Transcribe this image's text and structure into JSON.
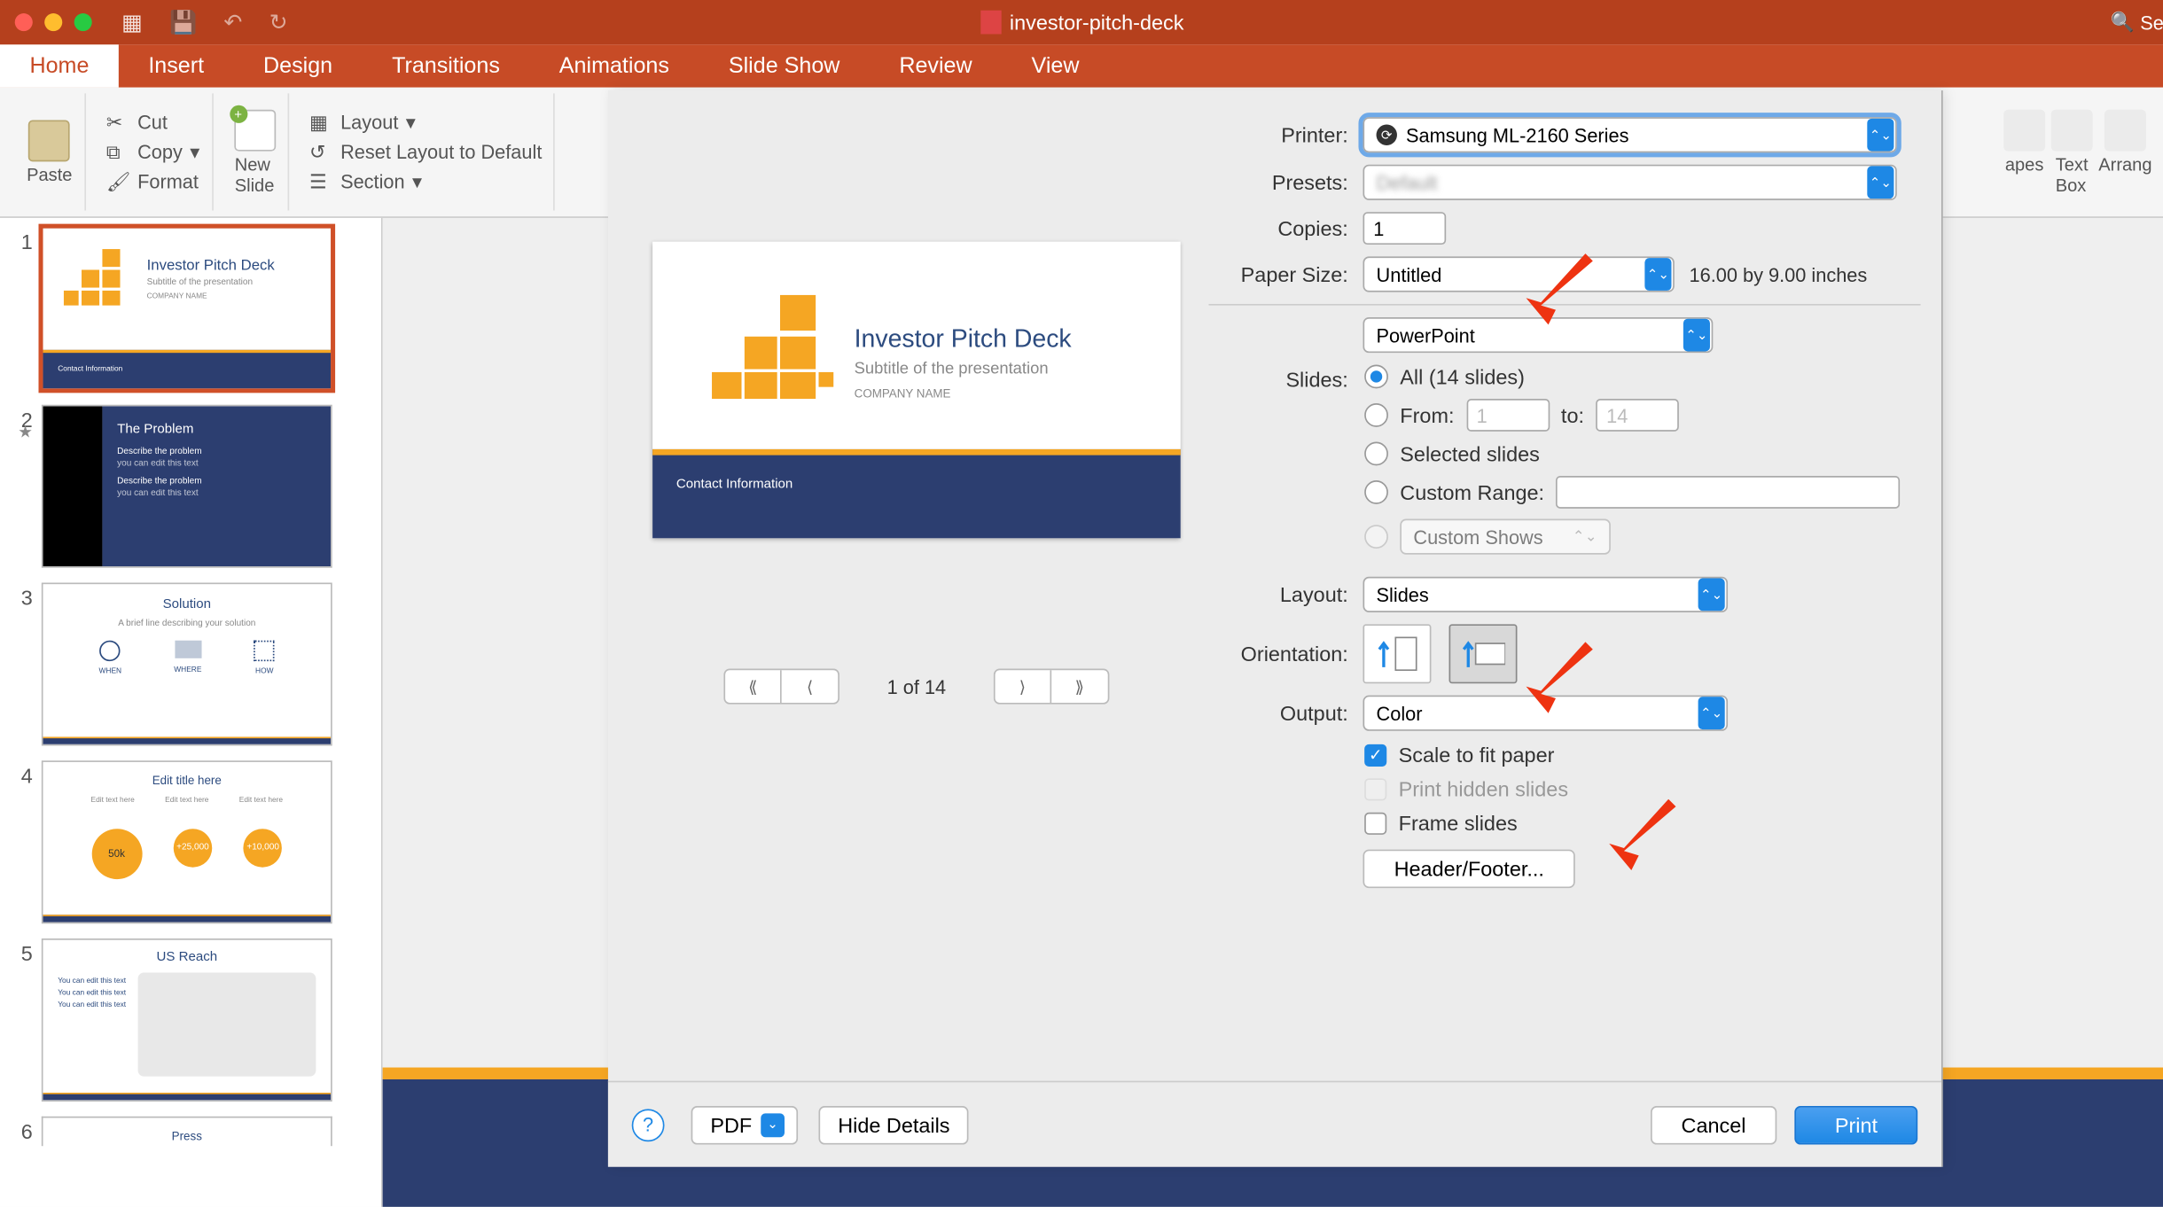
{
  "titlebar": {
    "doc_name": "investor-pitch-deck",
    "search_placeholder": "Se"
  },
  "tabs": [
    "Home",
    "Insert",
    "Design",
    "Transitions",
    "Animations",
    "Slide Show",
    "Review",
    "View"
  ],
  "active_tab": 0,
  "ribbon": {
    "paste": "Paste",
    "cut": "Cut",
    "copy": "Copy",
    "format": "Format",
    "new_slide": "New\nSlide",
    "layout": "Layout",
    "reset": "Reset Layout to Default",
    "section": "Section",
    "shapes": "apes",
    "textbox": "Text\nBox",
    "arrange": "Arrang"
  },
  "slides": [
    {
      "num": "1",
      "title": "Investor Pitch Deck",
      "sub": "Subtitle of the presentation",
      "company": "COMPANY NAME",
      "footer": "Contact Information"
    },
    {
      "num": "2",
      "title": "The Problem",
      "lines": [
        "Describe the problem",
        "you can edit this text",
        "Describe the problem",
        "you can edit this text"
      ]
    },
    {
      "num": "3",
      "title": "Solution",
      "sub": "A brief line describing your solution",
      "labels": [
        "WHEN",
        "WHERE",
        "HOW"
      ]
    },
    {
      "num": "4",
      "title": "Edit title here",
      "labels": [
        "Edit text here",
        "Edit text here",
        "Edit text here"
      ],
      "values": [
        "50k",
        "+25,000",
        "+10,000"
      ]
    },
    {
      "num": "5",
      "title": "US Reach",
      "lines": [
        "You can edit this text",
        "You can edit this text",
        "You can edit this text"
      ]
    },
    {
      "num": "6",
      "title": "Press"
    }
  ],
  "preview": {
    "title": "Investor Pitch Deck",
    "sub": "Subtitle of the presentation",
    "company": "COMPANY NAME",
    "footer": "Contact Information",
    "counter": "1 of 14"
  },
  "print": {
    "printer_label": "Printer:",
    "printer_value": "Samsung ML-2160 Series",
    "presets_label": "Presets:",
    "presets_value": "",
    "copies_label": "Copies:",
    "copies_value": "1",
    "paper_size_label": "Paper Size:",
    "paper_size_value": "Untitled",
    "paper_size_dims": "16.00 by 9.00 inches",
    "app_dropdown": "PowerPoint",
    "slides_label": "Slides:",
    "all_label": "All  (14 slides)",
    "from_label": "From:",
    "from_value": "1",
    "to_label": "to:",
    "to_value": "14",
    "selected_label": "Selected slides",
    "custom_range_label": "Custom Range:",
    "custom_shows_label": "Custom Shows",
    "layout_label": "Layout:",
    "layout_value": "Slides",
    "orientation_label": "Orientation:",
    "output_label": "Output:",
    "output_value": "Color",
    "scale_label": "Scale to fit paper",
    "hidden_label": "Print hidden slides",
    "frame_label": "Frame slides",
    "header_footer_btn": "Header/Footer...",
    "pdf_btn": "PDF",
    "hide_details_btn": "Hide Details",
    "cancel_btn": "Cancel",
    "print_btn": "Print"
  }
}
